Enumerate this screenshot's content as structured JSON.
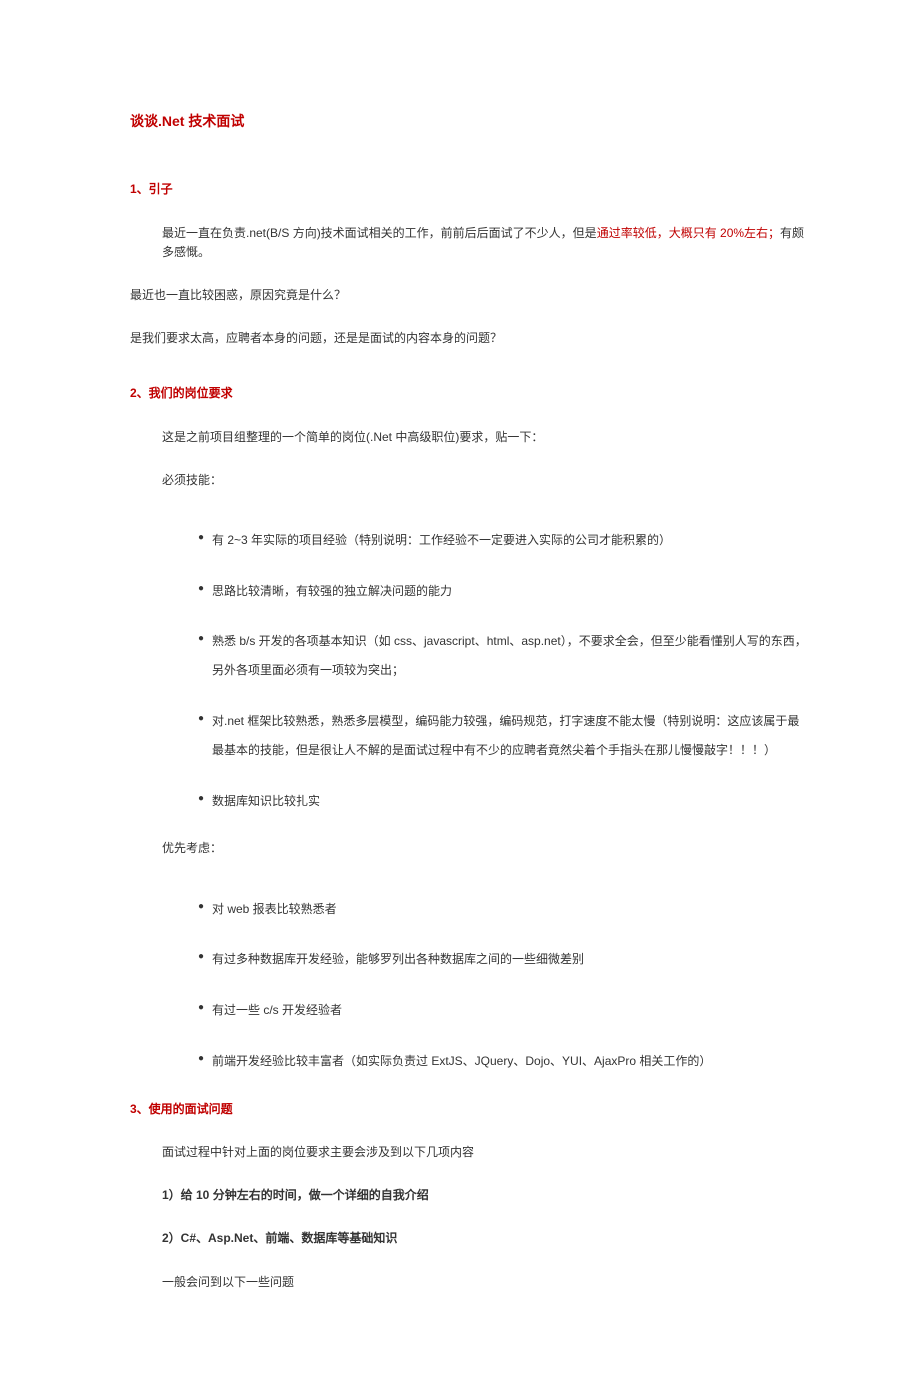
{
  "title": "谈谈.Net 技术面试",
  "s1": {
    "head": "1、引子",
    "p1_pre": "最近一直在负责.net(B/S 方向)技术面试相关的工作，前前后后面试了不少人，但是",
    "p1_hl": "通过率较低，大概只有 20%左右；",
    "p1_post": "有颇多感慨。",
    "p2": "最近也一直比较困惑，原因究竟是什么？",
    "p3": "是我们要求太高，应聘者本身的问题，还是是面试的内容本身的问题？"
  },
  "s2": {
    "head": "2、我们的岗位要求",
    "intro": "这是之前项目组整理的一个简单的岗位(.Net 中高级职位)要求，贴一下：",
    "must_label": "必须技能：",
    "must_items": [
      "有 2~3 年实际的项目经验（特别说明：工作经验不一定要进入实际的公司才能积累的）",
      "思路比较清晰，有较强的独立解决问题的能力",
      "熟悉 b/s 开发的各项基本知识（如 css、javascript、html、asp.net），不要求全会，但至少能看懂别人写的东西，另外各项里面必须有一项较为突出；",
      "对.net 框架比较熟悉，熟悉多层模型，编码能力较强，编码规范，打字速度不能太慢（特别说明：这应该属于最最基本的技能，但是很让人不解的是面试过程中有不少的应聘者竟然尖着个手指头在那儿慢慢敲字！！！）",
      "数据库知识比较扎实"
    ],
    "pref_label": "优先考虑：",
    "pref_items": [
      "对 web 报表比较熟悉者",
      "有过多种数据库开发经验，能够罗列出各种数据库之间的一些细微差别",
      "有过一些 c/s 开发经验者",
      "前端开发经验比较丰富者（如实际负责过 ExtJS、JQuery、Dojo、YUI、AjaxPro 相关工作的）"
    ]
  },
  "s3": {
    "head": "3、使用的面试问题",
    "intro": "面试过程中针对上面的岗位要求主要会涉及到以下几项内容",
    "q1": "1）给 10 分钟左右的时间，做一个详细的自我介绍",
    "q2": "2）C#、Asp.Net、前端、数据库等基础知识",
    "q2_note": "一般会问到以下一些问题"
  }
}
